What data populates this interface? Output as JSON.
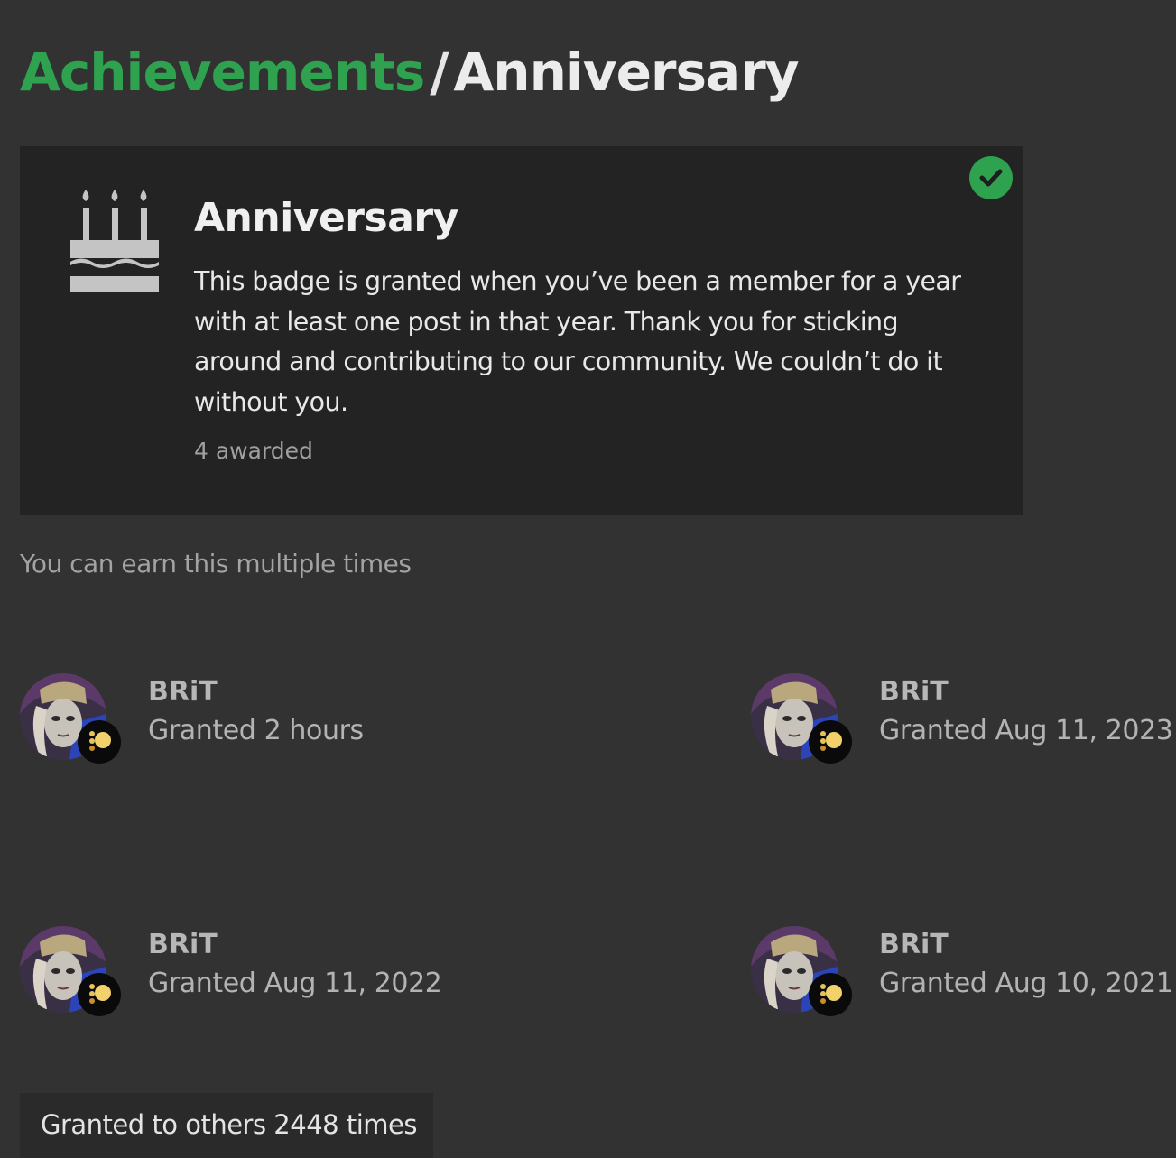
{
  "breadcrumb": {
    "parent": "Achievements",
    "separator": "/",
    "current": "Anniversary"
  },
  "badge": {
    "icon": "birthday-cake-icon",
    "status_icon": "check-circle-icon",
    "title": "Anniversary",
    "description": "This badge is granted when you’ve been a member for a year with at least one post in that year. Thank you for sticking around and contributing to our community. We couldn’t do it without you.",
    "awarded": "4 awarded"
  },
  "earn_note": "You can earn this multiple times",
  "grants": [
    {
      "user": "BRiT",
      "date": "Granted 2 hours"
    },
    {
      "user": "BRiT",
      "date": "Granted Aug 11, 2023"
    },
    {
      "user": "BRiT",
      "date": "Granted Aug 11, 2022"
    },
    {
      "user": "BRiT",
      "date": "Granted Aug 10, 2021"
    }
  ],
  "others": "Granted to others 2448 times",
  "colors": {
    "accent": "#2fa24f",
    "background": "#323232",
    "card": "#232323"
  }
}
